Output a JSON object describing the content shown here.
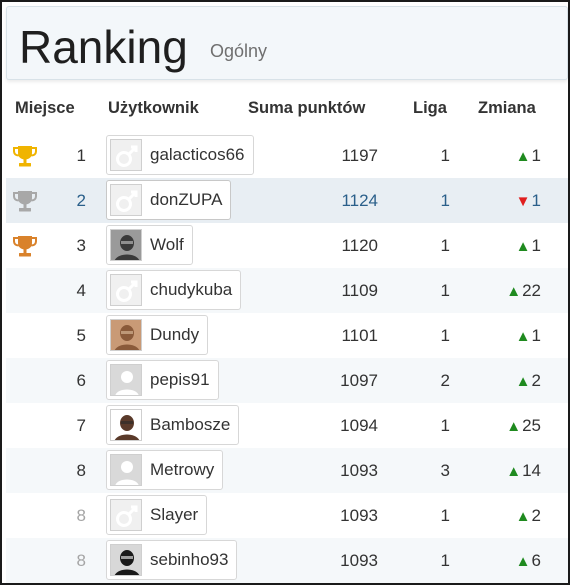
{
  "header": {
    "title": "Ranking",
    "subtitle": "Ogólny"
  },
  "columns": {
    "place": "Miejsce",
    "user": "Użytkownik",
    "points": "Suma punktów",
    "league": "Liga",
    "change": "Zmiana"
  },
  "colors": {
    "gold": "#f0b400",
    "silver": "#a8a8a8",
    "bronze": "#d9822b",
    "up": "#1f8a1f",
    "down": "#e01e1e",
    "link": "#2a5f8a"
  },
  "rows": [
    {
      "place": "1",
      "trophy": "gold-trophy-icon",
      "user": "galacticos66",
      "avatar": "male-placeholder-icon",
      "points": "1197",
      "league": "1",
      "direction": "up",
      "change": "1"
    },
    {
      "place": "2",
      "trophy": "silver-trophy-icon",
      "user": "donZUPA",
      "avatar": "male-placeholder-icon",
      "points": "1124",
      "league": "1",
      "direction": "down",
      "change": "1"
    },
    {
      "place": "3",
      "trophy": "bronze-trophy-icon",
      "user": "Wolf",
      "avatar": "photo-avatar",
      "points": "1120",
      "league": "1",
      "direction": "up",
      "change": "1"
    },
    {
      "place": "4",
      "user": "chudykuba",
      "avatar": "male-placeholder-icon",
      "points": "1109",
      "league": "1",
      "direction": "up",
      "change": "22"
    },
    {
      "place": "5",
      "user": "Dundy",
      "avatar": "photo-avatar",
      "points": "1101",
      "league": "1",
      "direction": "up",
      "change": "1"
    },
    {
      "place": "6",
      "user": "pepis91",
      "avatar": "default-person-icon",
      "points": "1097",
      "league": "2",
      "direction": "up",
      "change": "2"
    },
    {
      "place": "7",
      "user": "Bambosze",
      "avatar": "photo-avatar",
      "points": "1094",
      "league": "1",
      "direction": "up",
      "change": "25"
    },
    {
      "place": "8",
      "user": "Metrowy",
      "avatar": "default-person-icon",
      "points": "1093",
      "league": "3",
      "direction": "up",
      "change": "14"
    },
    {
      "place": "8",
      "user": "Slayer",
      "avatar": "male-placeholder-icon",
      "points": "1093",
      "league": "1",
      "direction": "up",
      "change": "2"
    },
    {
      "place": "8",
      "user": "sebinho93",
      "avatar": "photo-avatar",
      "points": "1093",
      "league": "1",
      "direction": "up",
      "change": "6"
    }
  ]
}
